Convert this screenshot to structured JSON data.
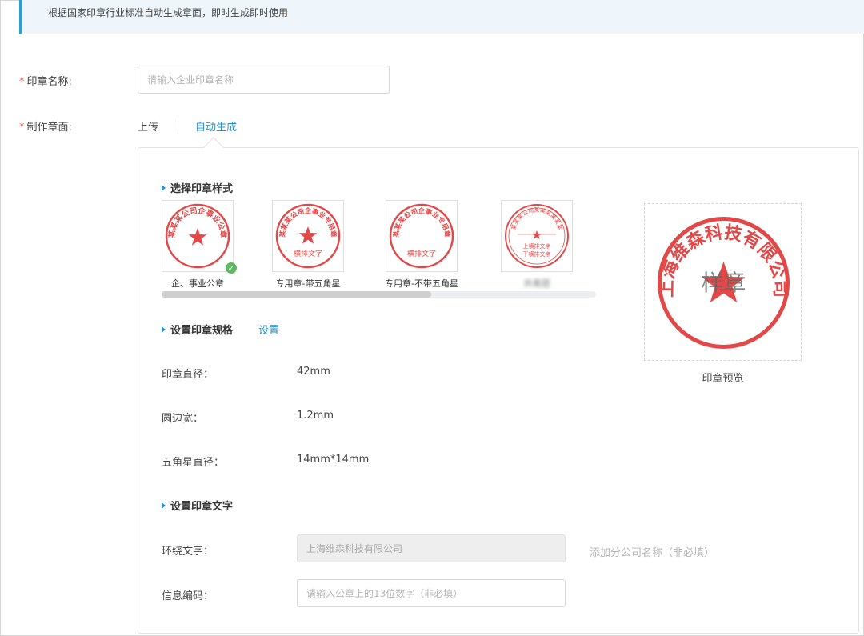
{
  "notice": "根据国家印章行业标准自动生成章面，即时生成即时使用",
  "form": {
    "seal_name": {
      "required_mark": "*",
      "label": "印章名称:",
      "placeholder": "请输入企业印章名称",
      "value": ""
    },
    "make_face": {
      "required_mark": "*",
      "label": "制作章面:",
      "tabs": [
        {
          "label": "上传",
          "active": false
        },
        {
          "label": "自动生成",
          "active": true
        }
      ]
    }
  },
  "style_section": {
    "title": "选择印章样式",
    "styles": [
      {
        "label": "企、事业公章",
        "ring_text": "某某某公司企事业公章",
        "center_text": "",
        "selected": true
      },
      {
        "label": "专用章-带五角星",
        "ring_text": "某某某公司企事业专用章",
        "center_text": "横排文字",
        "selected": false
      },
      {
        "label": "专用章-不带五角星",
        "ring_text": "某某某公司企事业专用章",
        "center_text": "横排文字",
        "selected": false
      },
      {
        "label": "共青团",
        "ring_text": "某某某公司某某某某某某",
        "center_text": "上横排文字",
        "bottom_text": "下横排文字",
        "selected": false
      }
    ],
    "scroll_position": 0.0
  },
  "spec_section": {
    "title": "设置印章规格",
    "set_link": "设置",
    "rows": [
      {
        "label": "印章直径：",
        "value": "42mm"
      },
      {
        "label": "圆边宽：",
        "value": "1.2mm"
      },
      {
        "label": "五角星直径：",
        "value": "14mm*14mm"
      }
    ]
  },
  "text_section": {
    "title": "设置印章文字",
    "ring_text": {
      "label": "环绕文字：",
      "value": "上海维森科技有限公司",
      "disabled": true
    },
    "branch_hint": "添加分公司名称（非必填）",
    "info_code": {
      "label": "信息编码：",
      "placeholder": "请输入公章上的13位数字（非必填）",
      "value": ""
    }
  },
  "preview": {
    "label": "印章预览",
    "ring_text": "上海维森科技有限公司",
    "watermark": "样章"
  },
  "colors": {
    "seal_red": "#e34848",
    "accent": "#2a8fc4",
    "required": "#e9513e",
    "selected_check": "#5cb85c"
  }
}
